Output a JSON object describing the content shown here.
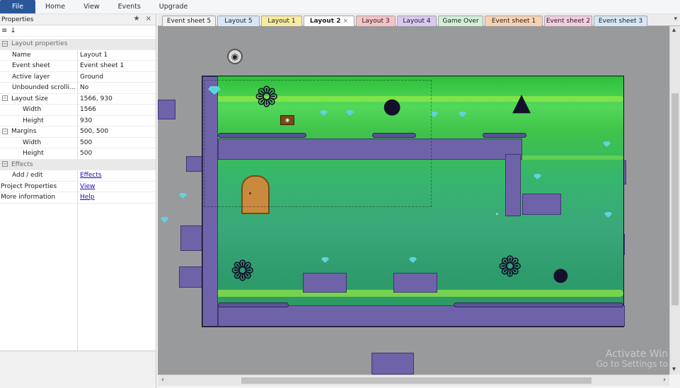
{
  "menu": {
    "items": [
      "File",
      "Home",
      "View",
      "Events",
      "Upgrade"
    ]
  },
  "properties_panel": {
    "title": "Properties",
    "pin_icon": "pin-icon",
    "close_icon": "close-icon",
    "tools": [
      "categorized-icon",
      "alphabetical-icon"
    ],
    "sections": {
      "layout": "Layout properties",
      "effects": "Effects"
    },
    "rows": {
      "name": {
        "label": "Name",
        "value": "Layout 1"
      },
      "event_sheet": {
        "label": "Event sheet",
        "value": "Event sheet 1"
      },
      "active_layer": {
        "label": "Active layer",
        "value": "Ground"
      },
      "unbounded": {
        "label": "Unbounded scrolli...",
        "value": "No"
      },
      "layout_size": {
        "label": "Layout Size",
        "value": "1566, 930"
      },
      "ls_width": {
        "label": "Width",
        "value": "1566"
      },
      "ls_height": {
        "label": "Height",
        "value": "930"
      },
      "margins": {
        "label": "Margins",
        "value": "500, 500"
      },
      "m_width": {
        "label": "Width",
        "value": "500"
      },
      "m_height": {
        "label": "Height",
        "value": "500"
      },
      "add_edit": {
        "label": "Add / edit",
        "value": "Effects"
      },
      "project_props": {
        "label": "Project Properties",
        "value": "View"
      },
      "more_info": {
        "label": "More information",
        "value": "Help"
      }
    }
  },
  "tabs": [
    {
      "label": "Event sheet 5",
      "color": "#f2f2f2"
    },
    {
      "label": "Layout 5",
      "color": "#d9e6f7"
    },
    {
      "label": "Layout 1",
      "color": "#f7ec9e"
    },
    {
      "label": "Layout 2",
      "color": "#ffffff",
      "active": true,
      "close": "×"
    },
    {
      "label": "Layout 3",
      "color": "#f6c2c6"
    },
    {
      "label": "Layout 4",
      "color": "#d9c8ef"
    },
    {
      "label": "Game Over",
      "color": "#d2efd7"
    },
    {
      "label": "Event sheet 1",
      "color": "#f8d2b0"
    },
    {
      "label": "Event sheet 2",
      "color": "#f5cde3"
    },
    {
      "label": "Event sheet 3",
      "color": "#d6e8f7"
    }
  ],
  "tabs_menu_icon": "dropdown-icon",
  "watermark": {
    "line1": "Activate Win",
    "line2": "Go to Settings to"
  }
}
